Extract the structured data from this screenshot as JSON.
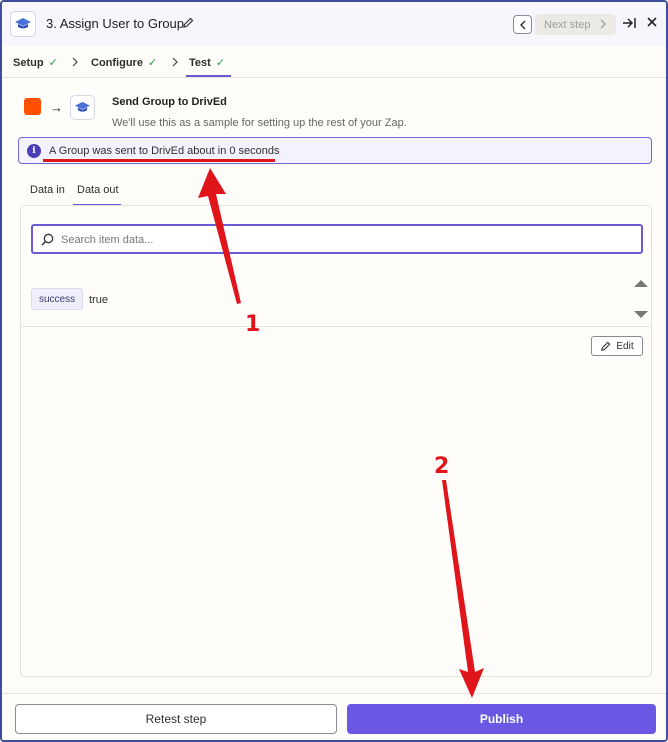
{
  "header": {
    "step_title": "3. Assign User to Group",
    "next_step_label": "Next step",
    "icons": [
      "graduation-cap-icon",
      "pencil-icon",
      "chevron-left-icon",
      "chevron-right-icon",
      "expand-right-icon",
      "close-icon"
    ]
  },
  "tabs": [
    {
      "label": "Setup",
      "status": "complete"
    },
    {
      "label": "Configure",
      "status": "complete"
    },
    {
      "label": "Test",
      "status": "complete",
      "active": true
    }
  ],
  "step_info": {
    "title": "Send Group to DrivEd",
    "subtitle": "We'll use this as a sample for setting up the rest of your Zap."
  },
  "banner": {
    "text": "A Group was sent to DrivEd about in 0 seconds"
  },
  "data_tabs": [
    {
      "label": "Data in"
    },
    {
      "label": "Data out",
      "active": true
    }
  ],
  "search": {
    "placeholder": "Search item data..."
  },
  "data_out": [
    {
      "key": "success",
      "value": "true"
    }
  ],
  "edit_label": "Edit",
  "footer": {
    "retest_label": "Retest step",
    "publish_label": "Publish"
  },
  "annotations": [
    {
      "label": "1"
    },
    {
      "label": "2"
    }
  ],
  "colors": {
    "accent": "#6a57e3",
    "annotation_red": "#e0141b",
    "source_app": "#ff4f00",
    "check_green": "#2c9a51"
  }
}
